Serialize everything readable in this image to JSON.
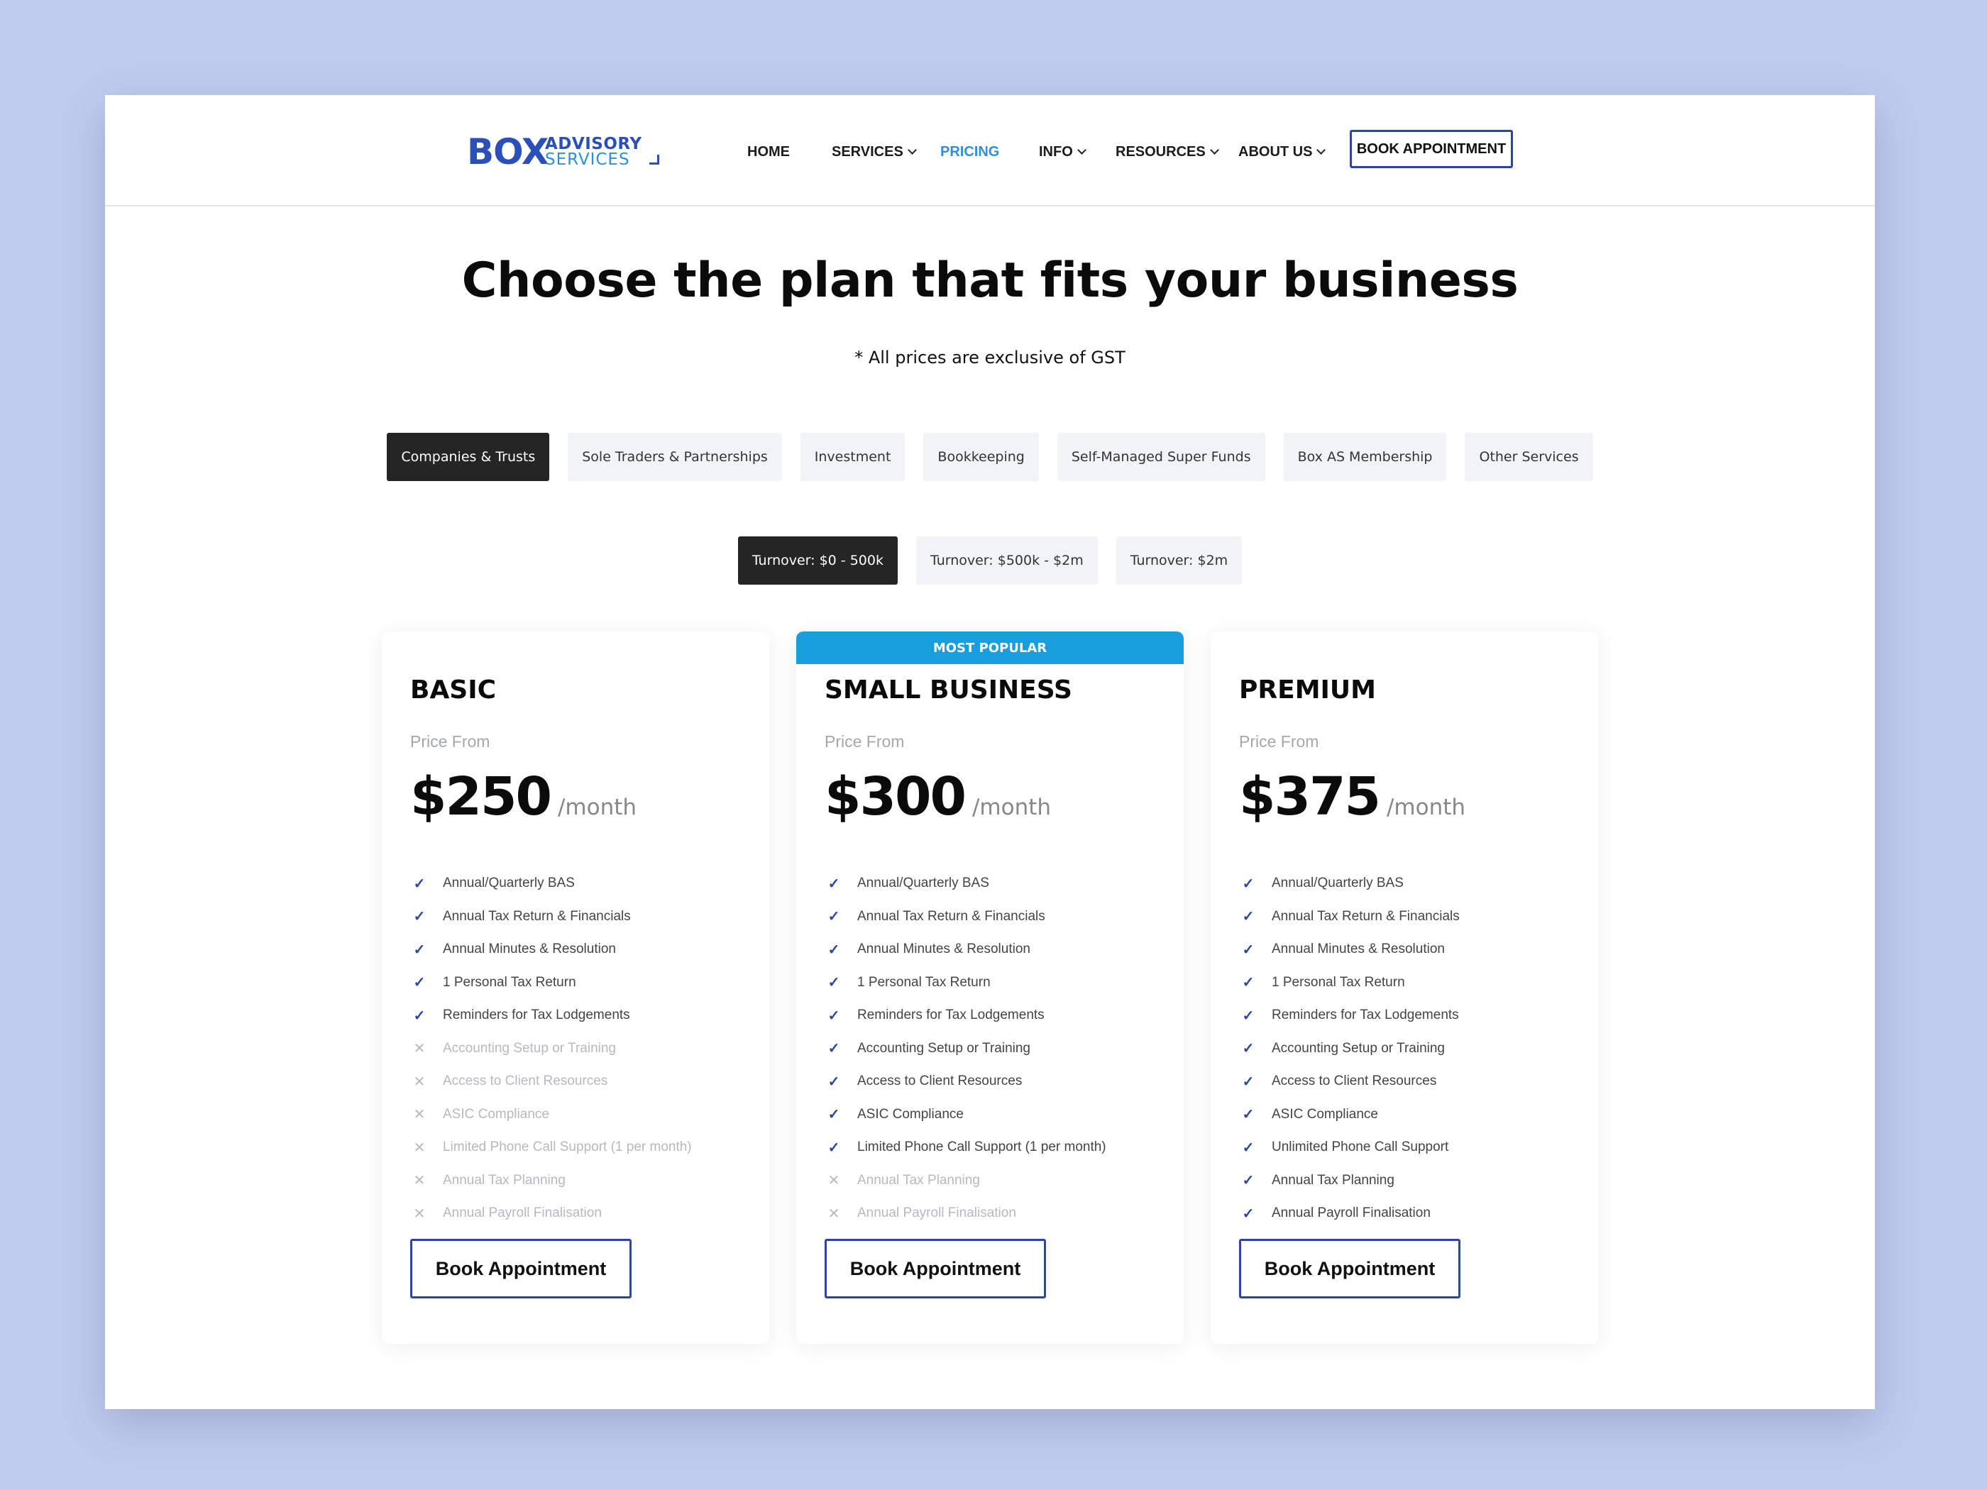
{
  "brand": {
    "logo_main": "BOX",
    "logo_line1": "ADVISORY",
    "logo_line2": "SERVICES"
  },
  "nav": {
    "items": [
      {
        "label": "HOME",
        "has_dropdown": false,
        "active": false
      },
      {
        "label": "SERVICES",
        "has_dropdown": true,
        "active": false
      },
      {
        "label": "PRICING",
        "has_dropdown": false,
        "active": true
      },
      {
        "label": "INFO",
        "has_dropdown": true,
        "active": false
      },
      {
        "label": "RESOURCES",
        "has_dropdown": true,
        "active": false
      },
      {
        "label": "ABOUT US",
        "has_dropdown": true,
        "active": false
      }
    ],
    "cta_label": "BOOK APPOINTMENT"
  },
  "hero": {
    "title": "Choose the plan that fits your business",
    "subtitle": "* All prices are exclusive of GST"
  },
  "category_tabs": [
    {
      "label": "Companies & Trusts",
      "active": true
    },
    {
      "label": "Sole Traders & Partnerships",
      "active": false
    },
    {
      "label": "Investment",
      "active": false
    },
    {
      "label": "Bookkeeping",
      "active": false
    },
    {
      "label": "Self-Managed Super Funds",
      "active": false
    },
    {
      "label": "Box AS Membership",
      "active": false
    },
    {
      "label": "Other Services",
      "active": false
    }
  ],
  "turnover_tabs": [
    {
      "label": "Turnover: $0 - 500k",
      "active": true
    },
    {
      "label": "Turnover: $500k - $2m",
      "active": false
    },
    {
      "label": "Turnover: $2m",
      "active": false
    }
  ],
  "plans": [
    {
      "name": "BASIC",
      "ribbon": "",
      "price_from_label": "Price From",
      "price": "$250",
      "period": "/month",
      "button_label": "Book Appointment",
      "features": [
        {
          "text": "Annual/Quarterly BAS",
          "included": true
        },
        {
          "text": "Annual Tax Return & Financials",
          "included": true
        },
        {
          "text": "Annual Minutes & Resolution",
          "included": true
        },
        {
          "text": "1 Personal Tax Return",
          "included": true
        },
        {
          "text": "Reminders for Tax Lodgements",
          "included": true
        },
        {
          "text": "Accounting Setup or Training",
          "included": false
        },
        {
          "text": "Access to Client Resources",
          "included": false
        },
        {
          "text": "ASIC Compliance",
          "included": false
        },
        {
          "text": "Limited Phone Call Support (1 per month)",
          "included": false
        },
        {
          "text": "Annual Tax Planning",
          "included": false
        },
        {
          "text": "Annual Payroll Finalisation",
          "included": false
        }
      ]
    },
    {
      "name": "SMALL BUSINESS",
      "ribbon": "MOST POPULAR",
      "price_from_label": "Price From",
      "price": "$300",
      "period": "/month",
      "button_label": "Book Appointment",
      "features": [
        {
          "text": "Annual/Quarterly BAS",
          "included": true
        },
        {
          "text": "Annual Tax Return & Financials",
          "included": true
        },
        {
          "text": "Annual Minutes & Resolution",
          "included": true
        },
        {
          "text": "1 Personal Tax Return",
          "included": true
        },
        {
          "text": "Reminders for Tax Lodgements",
          "included": true
        },
        {
          "text": "Accounting Setup or Training",
          "included": true
        },
        {
          "text": "Access to Client Resources",
          "included": true
        },
        {
          "text": "ASIC Compliance",
          "included": true
        },
        {
          "text": "Limited Phone Call Support (1 per month)",
          "included": true
        },
        {
          "text": "Annual Tax Planning",
          "included": false
        },
        {
          "text": "Annual Payroll Finalisation",
          "included": false
        }
      ]
    },
    {
      "name": "PREMIUM",
      "ribbon": "",
      "price_from_label": "Price From",
      "price": "$375",
      "period": "/month",
      "button_label": "Book Appointment",
      "features": [
        {
          "text": "Annual/Quarterly BAS",
          "included": true
        },
        {
          "text": "Annual Tax Return & Financials",
          "included": true
        },
        {
          "text": "Annual Minutes & Resolution",
          "included": true
        },
        {
          "text": "1 Personal Tax Return",
          "included": true
        },
        {
          "text": "Reminders for Tax Lodgements",
          "included": true
        },
        {
          "text": "Accounting Setup or Training",
          "included": true
        },
        {
          "text": "Access to Client Resources",
          "included": true
        },
        {
          "text": "ASIC Compliance",
          "included": true
        },
        {
          "text": "Unlimited Phone Call Support",
          "included": true
        },
        {
          "text": "Annual Tax Planning",
          "included": true
        },
        {
          "text": "Annual Payroll Finalisation",
          "included": true
        }
      ]
    }
  ],
  "colors": {
    "page_background": "#c0ccee",
    "brand_blue": "#2a4fb8",
    "accent_blue": "#189ddd",
    "active_nav": "#2e8fdf",
    "active_tab_bg": "#252525"
  }
}
